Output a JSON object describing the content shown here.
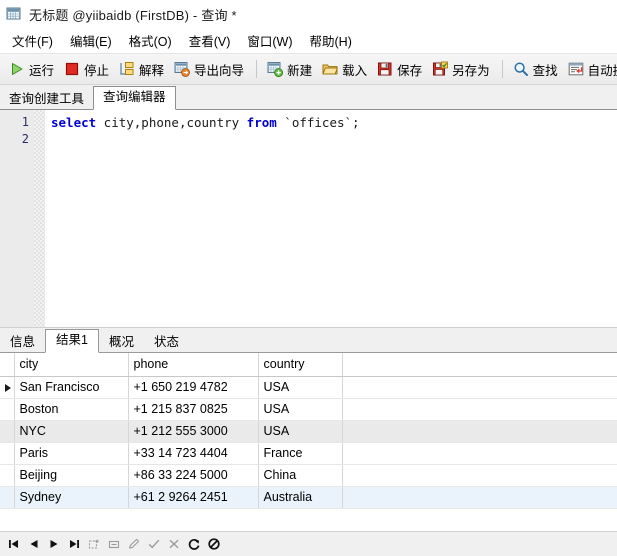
{
  "window": {
    "title": "无标题 @yiibaidb (FirstDB) - 查询 *",
    "icon": "query-window-icon"
  },
  "menubar": {
    "items": [
      {
        "label": "文件(F)",
        "name": "menu-file"
      },
      {
        "label": "编辑(E)",
        "name": "menu-edit"
      },
      {
        "label": "格式(O)",
        "name": "menu-format"
      },
      {
        "label": "查看(V)",
        "name": "menu-view"
      },
      {
        "label": "窗口(W)",
        "name": "menu-window"
      },
      {
        "label": "帮助(H)",
        "name": "menu-help"
      }
    ]
  },
  "toolbar": {
    "buttons": [
      {
        "label": "运行",
        "icon": "run-play-icon",
        "name": "run-button"
      },
      {
        "label": "停止",
        "icon": "stop-square-icon",
        "name": "stop-button"
      },
      {
        "label": "解释",
        "icon": "explain-icon",
        "name": "explain-button"
      },
      {
        "label": "导出向导",
        "icon": "export-wizard-icon",
        "name": "export-wizard-button"
      },
      {
        "label": "新建",
        "icon": "new-query-icon",
        "name": "new-button"
      },
      {
        "label": "载入",
        "icon": "open-folder-icon",
        "name": "load-button"
      },
      {
        "label": "保存",
        "icon": "save-disk-icon",
        "name": "save-button"
      },
      {
        "label": "另存为",
        "icon": "save-as-disk-icon",
        "name": "save-as-button"
      },
      {
        "label": "查找",
        "icon": "search-icon",
        "name": "find-button"
      },
      {
        "label": "自动换行",
        "icon": "word-wrap-icon",
        "name": "word-wrap-button"
      }
    ]
  },
  "editor_tabs": {
    "items": [
      {
        "label": "查询创建工具",
        "active": false,
        "name": "tab-query-builder"
      },
      {
        "label": "查询编辑器",
        "active": true,
        "name": "tab-query-editor"
      }
    ]
  },
  "editor": {
    "line_numbers": [
      "1",
      "2"
    ],
    "sql": {
      "keyword1": "select",
      "columns": " city,phone,country ",
      "keyword2": "from",
      "table": " `offices`;"
    }
  },
  "result_tabs": {
    "items": [
      {
        "label": "信息",
        "active": false,
        "name": "tab-info"
      },
      {
        "label": "结果1",
        "active": true,
        "name": "tab-result1"
      },
      {
        "label": "概况",
        "active": false,
        "name": "tab-profile"
      },
      {
        "label": "状态",
        "active": false,
        "name": "tab-status"
      }
    ]
  },
  "grid": {
    "headers": [
      "city",
      "phone",
      "country"
    ],
    "selected_header_index": 0,
    "current_row_index": 0,
    "rows": [
      {
        "city": "San Francisco",
        "phone": "+1 650 219 4782",
        "country": "USA",
        "style": "current"
      },
      {
        "city": "Boston",
        "phone": "+1 215 837 0825",
        "country": "USA",
        "style": "normal"
      },
      {
        "city": "NYC",
        "phone": "+1 212 555 3000",
        "country": "USA",
        "style": "selected"
      },
      {
        "city": "Paris",
        "phone": "+33 14 723 4404",
        "country": "France",
        "style": "normal"
      },
      {
        "city": "Beijing",
        "phone": "+86 33 224 5000",
        "country": "China",
        "style": "normal"
      },
      {
        "city": "Sydney",
        "phone": "+61 2 9264 2451",
        "country": "Australia",
        "style": "tint"
      }
    ]
  },
  "navbar": {
    "buttons": [
      {
        "icon": "first-record-icon",
        "name": "nav-first"
      },
      {
        "icon": "prev-record-icon",
        "name": "nav-prev"
      },
      {
        "icon": "next-record-icon",
        "name": "nav-next"
      },
      {
        "icon": "last-record-icon",
        "name": "nav-last"
      },
      {
        "icon": "add-record-icon",
        "name": "nav-add"
      },
      {
        "icon": "delete-record-icon",
        "name": "nav-delete"
      },
      {
        "icon": "edit-record-icon",
        "name": "nav-edit"
      },
      {
        "icon": "apply-change-icon",
        "name": "nav-apply"
      },
      {
        "icon": "cancel-change-icon",
        "name": "nav-cancel"
      },
      {
        "icon": "refresh-icon",
        "name": "nav-refresh"
      },
      {
        "icon": "stop-load-icon",
        "name": "nav-stop"
      }
    ]
  },
  "colors": {
    "accent_blue": "#0000d0",
    "header_select": "#d9ebf7",
    "run_green": "#4ba32f",
    "stop_red": "#d42a2a"
  }
}
